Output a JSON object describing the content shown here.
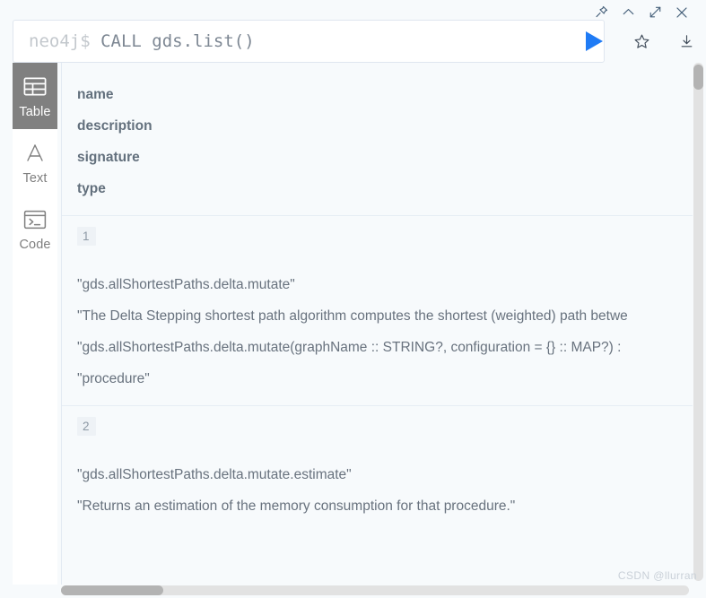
{
  "window_controls": [
    {
      "name": "pin-icon",
      "label": "Pin"
    },
    {
      "name": "chevron-up-icon",
      "label": "Collapse"
    },
    {
      "name": "expand-icon",
      "label": "Expand"
    },
    {
      "name": "close-icon",
      "label": "Close"
    }
  ],
  "editor": {
    "prompt": "neo4j$ ",
    "query": "CALL gds.list()",
    "placeholder": "neo4j$",
    "actions": [
      {
        "name": "run-query-button",
        "label": "Run"
      },
      {
        "name": "favorite-icon",
        "label": "Save as favorite"
      },
      {
        "name": "download-icon",
        "label": "Download"
      }
    ]
  },
  "view_switcher": {
    "items": [
      {
        "label": "Table",
        "icon": "table-icon",
        "active": true
      },
      {
        "label": "Text",
        "icon": "text-icon",
        "active": false
      },
      {
        "label": "Code",
        "icon": "code-icon",
        "active": false
      }
    ]
  },
  "result": {
    "columns": [
      "name",
      "description",
      "signature",
      "type"
    ],
    "rows": [
      {
        "index": "1",
        "cells": [
          "\"gds.allShortestPaths.delta.mutate\"",
          "\"The Delta Stepping shortest path algorithm computes the shortest (weighted) path betwe",
          "\"gds.allShortestPaths.delta.mutate(graphName :: STRING?, configuration = {} :: MAP?) :",
          "\"procedure\""
        ]
      },
      {
        "index": "2",
        "cells": [
          "\"gds.allShortestPaths.delta.mutate.estimate\"",
          "\"Returns an estimation of the memory consumption for that procedure.\""
        ]
      }
    ]
  },
  "watermark": "CSDN @llurran",
  "colors": {
    "background": "#f7fafc",
    "accent_blue": "#1f7bf5",
    "active_view": "#808080",
    "text_gray": "#68727e",
    "header_gray": "#63707d"
  }
}
